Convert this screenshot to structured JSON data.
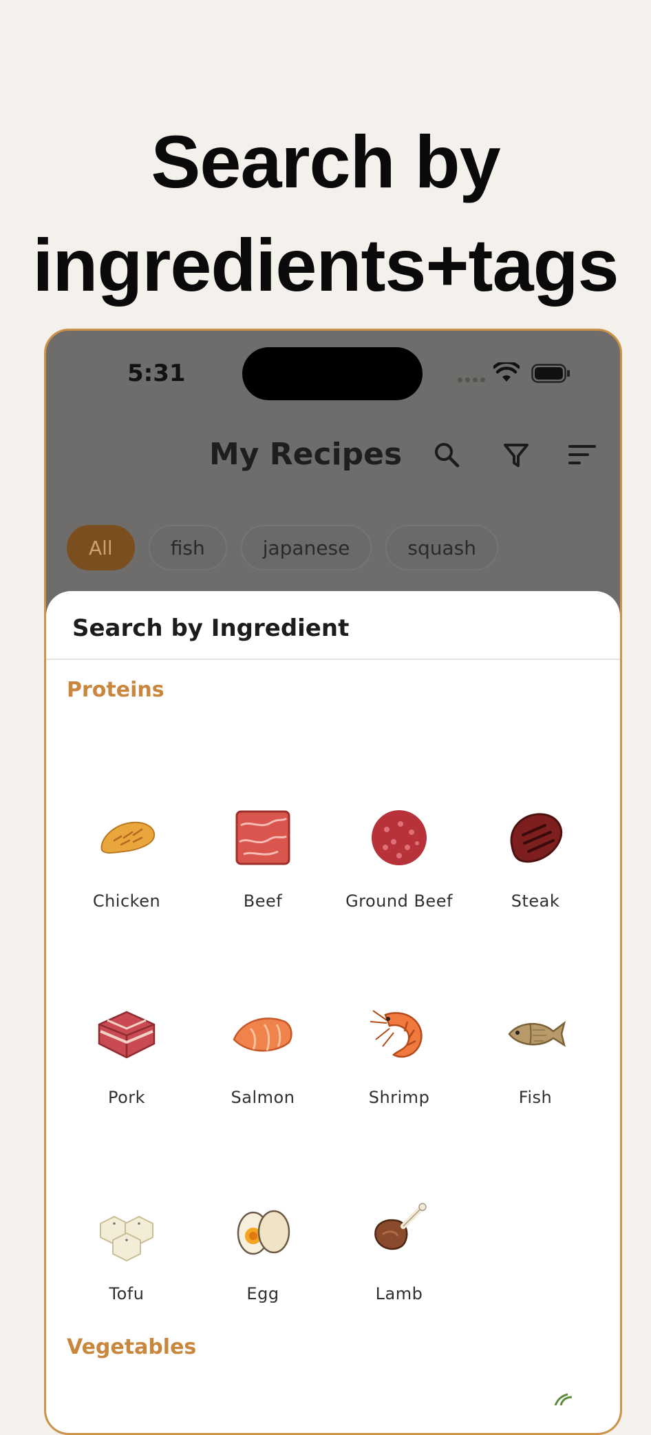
{
  "headline": {
    "line1": "Search by",
    "line2": "ingredients+tags"
  },
  "status_bar": {
    "time": "5:31"
  },
  "header": {
    "title": "My Recipes"
  },
  "chips": [
    {
      "label": "All"
    },
    {
      "label": "fish"
    },
    {
      "label": "japanese"
    },
    {
      "label": "squash"
    }
  ],
  "sheet": {
    "title": "Search by Ingredient",
    "sections": [
      {
        "name": "Proteins",
        "items": [
          {
            "label": "Chicken",
            "icon": "chicken-icon"
          },
          {
            "label": "Beef",
            "icon": "beef-icon"
          },
          {
            "label": "Ground Beef",
            "icon": "ground-beef-icon"
          },
          {
            "label": "Steak",
            "icon": "steak-icon"
          },
          {
            "label": "Pork",
            "icon": "pork-icon"
          },
          {
            "label": "Salmon",
            "icon": "salmon-icon"
          },
          {
            "label": "Shrimp",
            "icon": "shrimp-icon"
          },
          {
            "label": "Fish",
            "icon": "fish-icon"
          },
          {
            "label": "Tofu",
            "icon": "tofu-icon"
          },
          {
            "label": "Egg",
            "icon": "egg-icon"
          },
          {
            "label": "Lamb",
            "icon": "lamb-icon"
          }
        ]
      },
      {
        "name": "Vegetables",
        "items": []
      }
    ]
  },
  "colors": {
    "accent": "#c8873c",
    "active_chip": "#7b4e1f",
    "frame": "#cc9347"
  }
}
